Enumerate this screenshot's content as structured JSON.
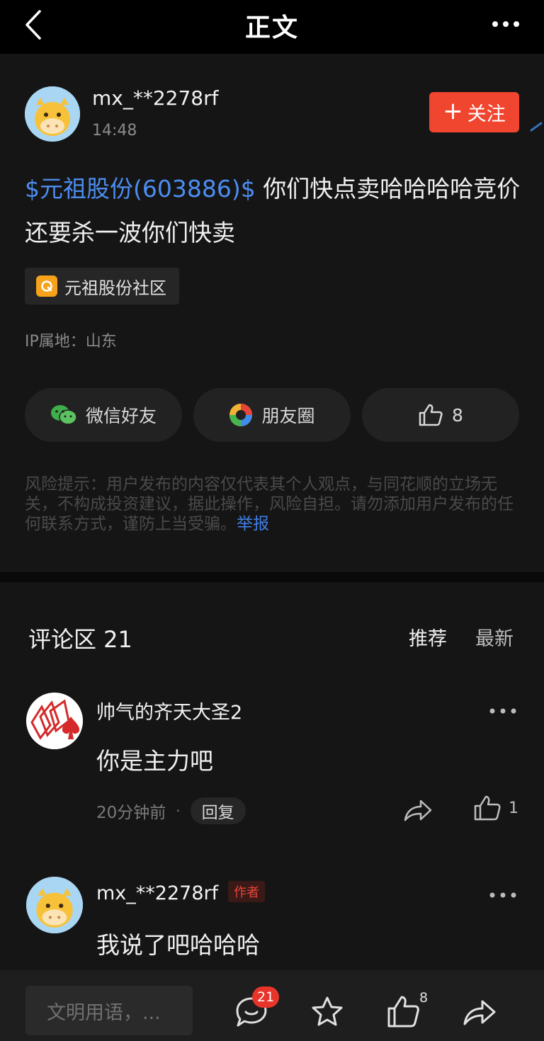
{
  "header": {
    "title": "正文"
  },
  "post": {
    "author": "mx_**2278rf",
    "time": "14:48",
    "follow_label": "关注",
    "stock_link": "$元祖股份(603886)$",
    "content_after_link": " 你们快点卖哈哈哈哈竞价还要杀一波你们快卖",
    "community_tag": "元祖股份社区",
    "ip_location": "IP属地：山东",
    "share_wechat": "微信好友",
    "share_moments": "朋友圈",
    "like_count": "8",
    "risk_note": "风险提示：用户发布的内容仅代表其个人观点，与同花顺的立场无关，不构成投资建议，据此操作，风险自担。请勿添加用户发布的任何联系方式，谨防上当受骗。",
    "report_label": "举报"
  },
  "comments_section": {
    "title": "评论区 21",
    "sort_recommended": "推荐",
    "sort_newest": "最新",
    "items": [
      {
        "name": "帅气的齐天大圣2",
        "text": "你是主力吧",
        "time": "20分钟前",
        "dot": "·",
        "reply_label": "回复",
        "like_count": "1"
      },
      {
        "name": "mx_**2278rf",
        "author_badge": "作者",
        "text": "我说了吧哈哈哈"
      }
    ]
  },
  "bottom_bar": {
    "input_placeholder": "文明用语，...",
    "comment_count": "21",
    "like_count": "8"
  },
  "colors": {
    "background": "#151515",
    "follow_button": "#f0452f",
    "link_blue": "#4c8df0",
    "badge_red": "#e8352c"
  },
  "icons": [
    "back-arrow-icon",
    "more-dots-icon",
    "wechat-icon",
    "moments-icon",
    "thumbs-up-icon",
    "share-icon",
    "comment-bubble-icon",
    "star-icon"
  ]
}
